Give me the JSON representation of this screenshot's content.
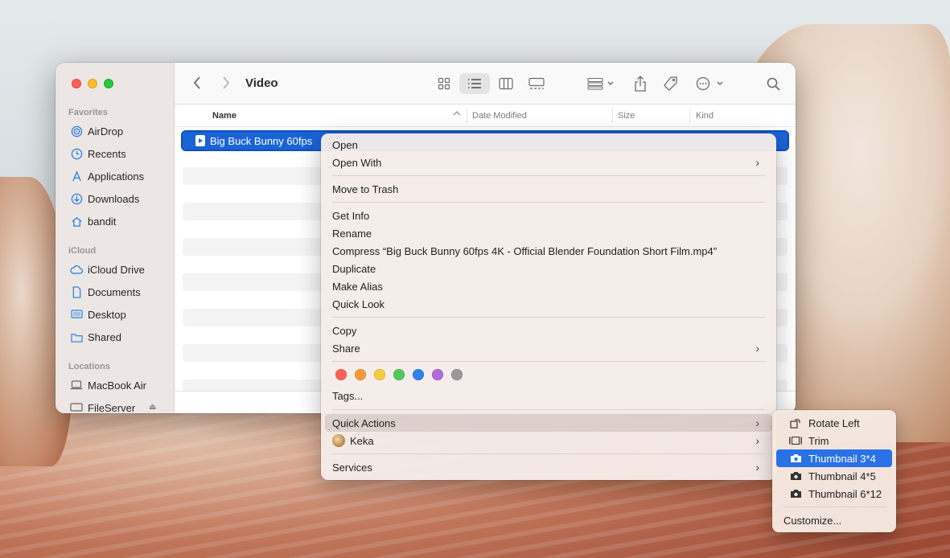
{
  "window": {
    "title": "Video",
    "sidebar": {
      "favorites_header": "Favorites",
      "favorites": [
        "AirDrop",
        "Recents",
        "Applications",
        "Downloads",
        "bandit"
      ],
      "icloud_header": "iCloud",
      "icloud": [
        "iCloud Drive",
        "Documents",
        "Desktop",
        "Shared"
      ],
      "locations_header": "Locations",
      "locations": [
        "MacBook Air",
        "FileServer"
      ]
    },
    "columns": {
      "name": "Name",
      "date_modified": "Date Modified",
      "size": "Size",
      "kind": "Kind"
    },
    "selected_file": "Big Buck Bunny 60fps"
  },
  "context_menu": {
    "open": "Open",
    "open_with": "Open With",
    "move_to_trash": "Move to Trash",
    "get_info": "Get Info",
    "rename": "Rename",
    "compress": "Compress “Big Buck Bunny 60fps 4K - Official Blender Foundation Short Film.mp4”",
    "duplicate": "Duplicate",
    "make_alias": "Make Alias",
    "quick_look": "Quick Look",
    "copy": "Copy",
    "share": "Share",
    "tag_colors": [
      "#fe5f57",
      "#f79a35",
      "#f6cc3f",
      "#4fc95e",
      "#2b84f0",
      "#b06bd8",
      "#9a9a9a"
    ],
    "tags": "Tags...",
    "quick_actions": "Quick Actions",
    "keka": "Keka",
    "services": "Services"
  },
  "submenu": {
    "items": [
      "Rotate Left",
      "Trim",
      "Thumbnail 3*4",
      "Thumbnail 4*5",
      "Thumbnail 6*12"
    ],
    "selected": "Thumbnail 3*4",
    "customize": "Customize..."
  }
}
